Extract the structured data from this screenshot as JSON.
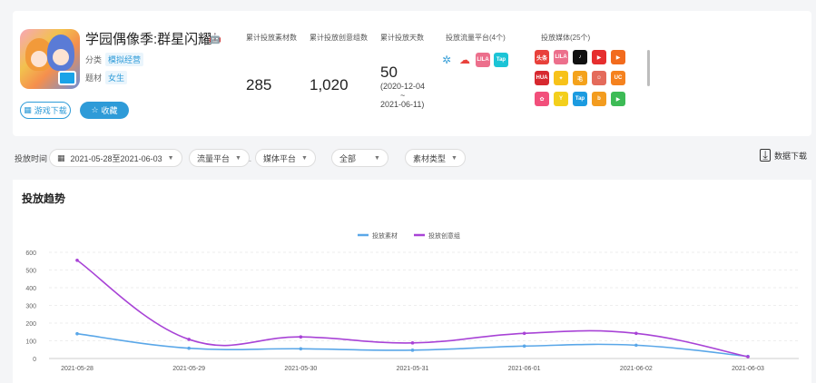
{
  "app": {
    "title": "学园偶像季:群星闪耀",
    "os_icons": [
      "android-icon",
      "apple-icon"
    ],
    "category_label": "分类",
    "category_value": "模拟经营",
    "theme_label": "题材",
    "theme_value": "女生",
    "download_button": "游戏下载",
    "favorite_button": "收藏"
  },
  "stats": {
    "materials_label": "累计投放素材数",
    "materials_value": "285",
    "creative_label": "累计投放创意组数",
    "creative_value": "1,020",
    "days_label": "累计投放天数",
    "days_value": "50",
    "range_start": "(2020-12-04",
    "range_tilde": "~",
    "range_end": "2021-06-11)",
    "flow_label": "投放流量平台(4个)",
    "media_label": "投放媒体(25个)"
  },
  "flow_platforms": [
    {
      "icon": "pinwheel-icon",
      "color": "#3aa0d8",
      "text": ""
    },
    {
      "icon": "cloud-icon",
      "color": "#e8413b",
      "text": ""
    },
    {
      "icon": "lilaa-icon",
      "color": "#ec6f8c",
      "text": "LILA"
    },
    {
      "icon": "tap-icon",
      "color": "#1cc4d6",
      "text": "Tap"
    }
  ],
  "media_platforms": [
    {
      "icon": "toutiao-icon",
      "color": "#e8413b",
      "text": "头条"
    },
    {
      "icon": "lilaa-icon",
      "color": "#ec6f8c",
      "text": "LILA"
    },
    {
      "icon": "tiktok-icon",
      "color": "#111111",
      "text": "♪"
    },
    {
      "icon": "video-red-icon",
      "color": "#e62e2e",
      "text": "▶"
    },
    {
      "icon": "video-orange-icon",
      "color": "#f26b1d",
      "text": "▶"
    },
    {
      "icon": "huawei-icon",
      "color": "#d7282f",
      "text": "HUA"
    },
    {
      "icon": "yellow-app-icon",
      "color": "#f7c21a",
      "text": "✦"
    },
    {
      "icon": "orange-app-icon",
      "color": "#f4a21b",
      "text": "毛"
    },
    {
      "icon": "character-icon",
      "color": "#e46b5b",
      "text": "☺"
    },
    {
      "icon": "uc-icon",
      "color": "#f5821f",
      "text": "UC"
    },
    {
      "icon": "colorful-icon",
      "color": "#f24f7b",
      "text": "✿"
    },
    {
      "icon": "figure-icon",
      "color": "#f3cf1c",
      "text": "Y"
    },
    {
      "icon": "tap-icon",
      "color": "#1c9be0",
      "text": "Tap"
    },
    {
      "icon": "b-icon",
      "color": "#f39c1f",
      "text": "b"
    },
    {
      "icon": "green-app-icon",
      "color": "#3dbb56",
      "text": "▶"
    }
  ],
  "filters": {
    "label": "投放时间",
    "date_range": "2021-05-28至2021-06-03",
    "flow_platform": "流量平台",
    "media_platform": "媒体平台",
    "all": "全部",
    "material_type": "素材类型",
    "export": "数据下载"
  },
  "chart_section": {
    "title": "投放趋势"
  },
  "chart_data": {
    "type": "line",
    "categories": [
      "2021-05-28",
      "2021-05-29",
      "2021-05-30",
      "2021-05-31",
      "2021-06-01",
      "2021-06-02",
      "2021-06-03"
    ],
    "series": [
      {
        "name": "投放素材",
        "color": "#5aa7e8",
        "values": [
          140,
          58,
          55,
          47,
          70,
          75,
          12
        ]
      },
      {
        "name": "投放创意组",
        "color": "#a843d6",
        "values": [
          555,
          108,
          122,
          88,
          142,
          142,
          10
        ]
      }
    ],
    "y_ticks": [
      0,
      100,
      200,
      300,
      400,
      500,
      600
    ],
    "ylim": [
      0,
      600
    ],
    "grid": true,
    "legend": "top-center"
  }
}
